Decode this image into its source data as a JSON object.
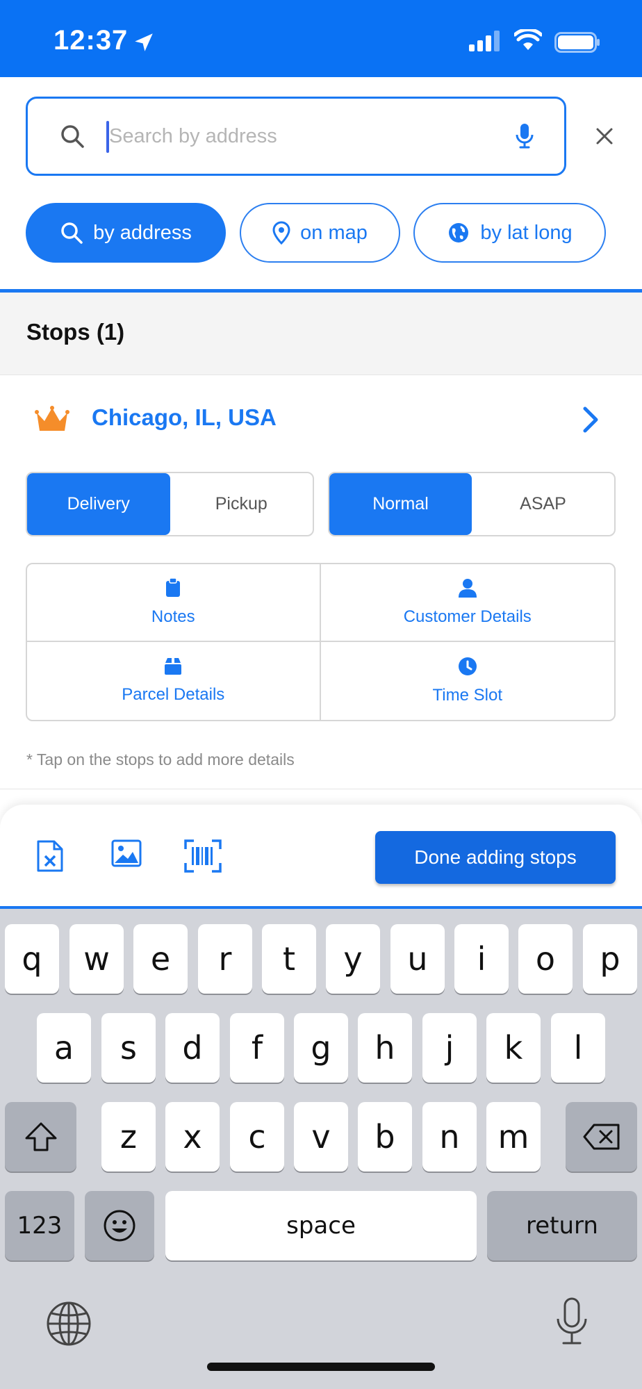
{
  "status_bar": {
    "time": "12:37"
  },
  "search": {
    "placeholder": "Search by address",
    "value": ""
  },
  "modes": [
    {
      "label": "by address",
      "icon": "search-icon",
      "active": true
    },
    {
      "label": "on map",
      "icon": "map-pin-icon",
      "active": false
    },
    {
      "label": "by lat long",
      "icon": "globe-icon",
      "active": false
    }
  ],
  "stops": {
    "title": "Stops (1)",
    "items": [
      {
        "address": "Chicago, IL, USA",
        "type_options": [
          "Delivery",
          "Pickup"
        ],
        "type_selected": "Delivery",
        "priority_options": [
          "Normal",
          "ASAP"
        ],
        "priority_selected": "Normal",
        "actions": [
          {
            "label": "Notes",
            "icon": "clipboard-icon"
          },
          {
            "label": "Customer Details",
            "icon": "person-icon"
          },
          {
            "label": "Parcel Details",
            "icon": "box-icon"
          },
          {
            "label": "Time Slot",
            "icon": "clock-icon"
          }
        ]
      }
    ],
    "hint": "* Tap on the stops to add more details"
  },
  "toolbar": {
    "icons": [
      "excel-file-icon",
      "image-icon",
      "barcode-scan-icon"
    ],
    "done_label": "Done adding stops"
  },
  "keyboard": {
    "row1": [
      "q",
      "w",
      "e",
      "r",
      "t",
      "y",
      "u",
      "i",
      "o",
      "p"
    ],
    "row2": [
      "a",
      "s",
      "d",
      "f",
      "g",
      "h",
      "j",
      "k",
      "l"
    ],
    "row3": [
      "z",
      "x",
      "c",
      "v",
      "b",
      "n",
      "m"
    ],
    "numbers_label": "123",
    "space_label": "space",
    "return_label": "return"
  },
  "colors": {
    "primary": "#1a78f2",
    "crown": "#f58d2a",
    "keyboard_bg": "#d2d4da"
  }
}
